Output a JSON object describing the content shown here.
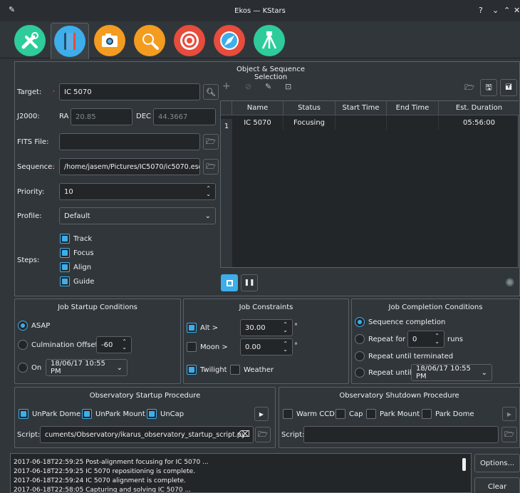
{
  "window": {
    "title": "Ekos — KStars",
    "controls": [
      "?",
      "⌄",
      "⌃",
      "✕"
    ]
  },
  "tabs": [
    {
      "name": "setup-tab",
      "color": "#2ecc9a",
      "icon": "wrench-screwdriver-icon"
    },
    {
      "name": "scheduler-tab",
      "color": "#3daee9",
      "icon": "notebook-icon",
      "active": true
    },
    {
      "name": "capture-tab",
      "color": "#f39c1f",
      "icon": "camera-icon"
    },
    {
      "name": "focus-tab",
      "color": "#f39c1f",
      "icon": "magnifier-icon"
    },
    {
      "name": "align-tab",
      "color": "#e74c3c",
      "icon": "target-icon"
    },
    {
      "name": "guide-tab",
      "color": "#e74c3c",
      "icon": "compass-icon"
    },
    {
      "name": "mount-tab",
      "color": "#2ecc9a",
      "icon": "tripod-icon"
    }
  ],
  "section_title": "Object & Sequence Selection",
  "form": {
    "target_label": "Target:",
    "target_value": "IC 5070",
    "j2000_label": "J2000:",
    "ra_label": "RA",
    "ra_value": "20.85",
    "dec_label": "DEC",
    "dec_value": "44.3667",
    "fits_label": "FITS File:",
    "sequence_label": "Sequence:",
    "sequence_value": "/home/jasem/Pictures/IC5070/ic5070.esq",
    "priority_label": "Priority:",
    "priority_value": "10",
    "profile_label": "Profile:",
    "profile_value": "Default",
    "steps_label": "Steps:",
    "steps": [
      "Track",
      "Focus",
      "Align",
      "Guide"
    ]
  },
  "table": {
    "headers": [
      "Name",
      "Status",
      "Start Time",
      "End Time",
      "Est. Duration"
    ],
    "rows": [
      {
        "index": "1",
        "name": "IC 5070",
        "status": "Focusing",
        "start": "",
        "end": "",
        "duration": "05:56:00"
      }
    ]
  },
  "startup_conditions": {
    "title": "Job Startup Conditions",
    "asap": "ASAP",
    "culmination": "Culmination Offset",
    "culmination_value": "-60",
    "on": "On",
    "on_value": "18/06/17 10:55 PM"
  },
  "constraints": {
    "title": "Job Constraints",
    "alt_label": "Alt >",
    "alt_value": "30.00",
    "moon_label": "Moon >",
    "moon_value": "0.00",
    "degree": "°",
    "twilight": "Twilight",
    "weather": "Weather"
  },
  "completion": {
    "title": "Job Completion Conditions",
    "sequence": "Sequence completion",
    "repeat_for": "Repeat for",
    "repeat_value": "0",
    "runs": "runs",
    "repeat_until_terminated": "Repeat until terminated",
    "repeat_until": "Repeat until",
    "repeat_until_value": "18/06/17 10:55 PM"
  },
  "obs_startup": {
    "title": "Observatory Startup Procedure",
    "unpark_dome": "UnPark Dome",
    "unpark_mount": "UnPark Mount",
    "uncap": "UnCap",
    "script_label": "Script:",
    "script_value": "cuments/Observatory/ikarus_observatory_startup_script.py"
  },
  "obs_shutdown": {
    "title": "Observatory Shutdown Procedure",
    "warm_ccd": "Warm CCD",
    "cap": "Cap",
    "park_mount": "Park Mount",
    "park_dome": "Park Dome",
    "script_label": "Script:",
    "script_value": ""
  },
  "log": [
    "2017-06-18T22:59:25 Post-alignment focusing for IC 5070 ...",
    "2017-06-18T22:59:25 IC 5070 repositioning is complete.",
    "2017-06-18T22:59:24 IC 5070 alignment is complete.",
    "2017-06-18T22:58:05 Capturing and solving IC 5070 ..."
  ],
  "buttons": {
    "options": "Options...",
    "clear": "Clear"
  }
}
